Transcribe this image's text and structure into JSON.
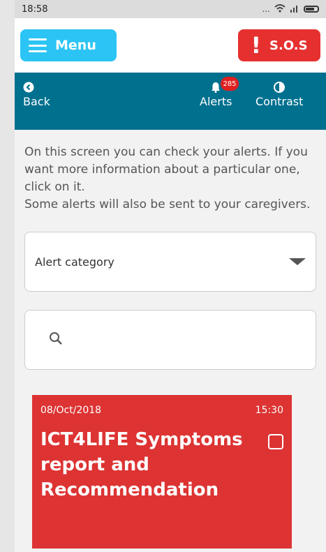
{
  "status": {
    "time": "18:58",
    "dots": "..."
  },
  "topbar": {
    "menu_label": "Menu",
    "sos_label": "S.O.S",
    "sos_mark": "!"
  },
  "nav": {
    "back_label": "Back",
    "alerts_label": "Alerts",
    "alerts_badge": "285",
    "contrast_label": "Contrast"
  },
  "description": {
    "line1": "On this screen you can check your alerts. If you want more information about a particular one, click on it.",
    "line2": "Some alerts will also be sent to your caregivers."
  },
  "filter": {
    "category_value": "Alert category"
  },
  "search": {
    "placeholder": ""
  },
  "alerts": [
    {
      "date": "08/Oct/2018",
      "time": "15:30",
      "title": "ICT4LIFE Symptoms report and Recommendation"
    }
  ],
  "colors": {
    "menu": "#2bc4f4",
    "sos": "#e63030",
    "navbar": "#00708f",
    "alert_card": "#dd3333"
  }
}
